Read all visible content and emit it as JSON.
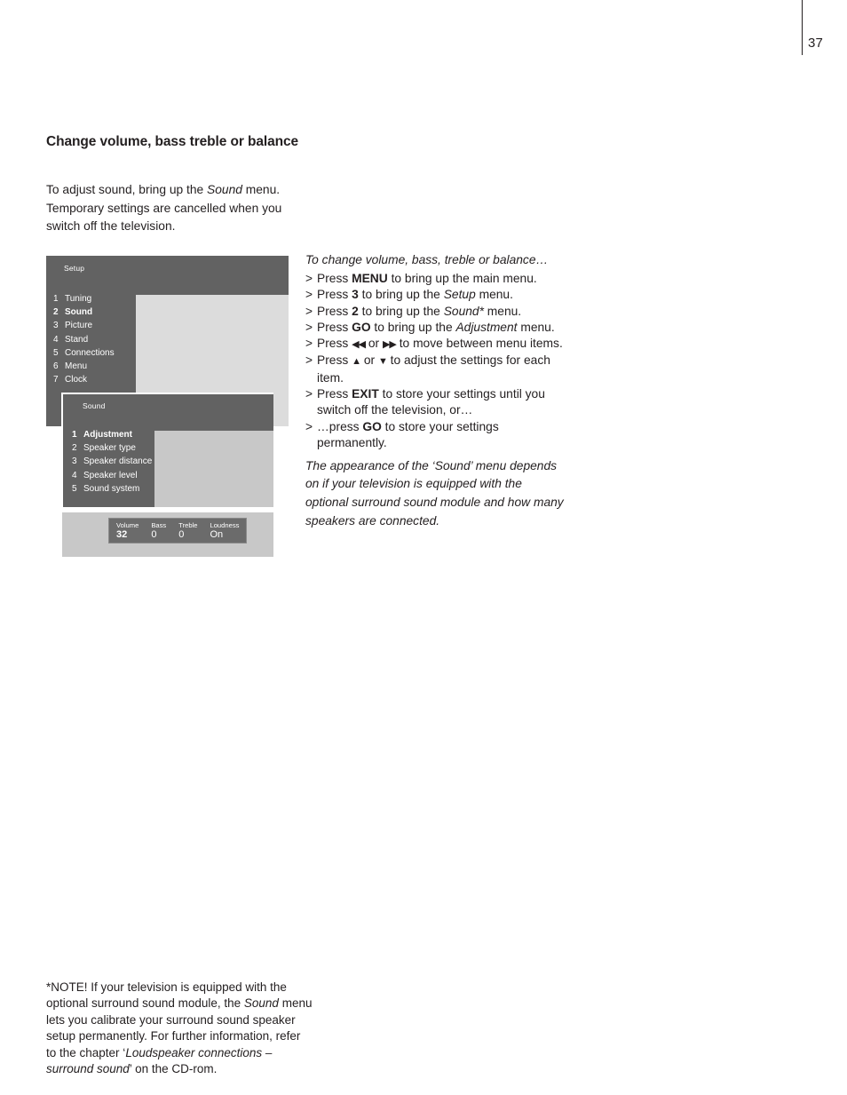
{
  "page": {
    "number": "37"
  },
  "headline": "Change volume, bass treble or balance",
  "intro": {
    "part1": "To adjust sound, bring up the ",
    "italic1": "Sound",
    "part2": " menu. Temporary settings are cancelled when you switch off the television."
  },
  "tv_graphic": {
    "setup_menu": {
      "title": "Setup",
      "items": [
        {
          "num": "1",
          "label": "Tuning",
          "selected": false
        },
        {
          "num": "2",
          "label": "Sound",
          "selected": true
        },
        {
          "num": "3",
          "label": "Picture",
          "selected": false
        },
        {
          "num": "4",
          "label": "Stand",
          "selected": false
        },
        {
          "num": "5",
          "label": "Connections",
          "selected": false
        },
        {
          "num": "6",
          "label": "Menu",
          "selected": false
        },
        {
          "num": "7",
          "label": "Clock",
          "selected": false
        }
      ]
    },
    "sound_menu": {
      "title": "Sound",
      "items": [
        {
          "num": "1",
          "label": "Adjustment",
          "selected": true
        },
        {
          "num": "2",
          "label": "Speaker type",
          "selected": false
        },
        {
          "num": "3",
          "label": "Speaker distance",
          "selected": false
        },
        {
          "num": "4",
          "label": "Speaker level",
          "selected": false
        },
        {
          "num": "5",
          "label": "Sound system",
          "selected": false
        }
      ]
    },
    "status_bar": [
      {
        "label": "Volume",
        "value": "32",
        "bold": true
      },
      {
        "label": "Bass",
        "value": "0",
        "bold": false
      },
      {
        "label": "Treble",
        "value": "0",
        "bold": false
      },
      {
        "label": "Loudness",
        "value": "On",
        "bold": false
      }
    ],
    "colors": {
      "menu_dark": "#626262",
      "menu_light": "#dcdcdc",
      "menu_light_alt": "#c8c8c8",
      "status_box": "#6b6b6b"
    }
  },
  "instructions": {
    "title": "To change volume, bass, treble or balance…",
    "marker": ">",
    "lines": [
      {
        "pre": "Press ",
        "key": "MENU",
        "post": " to bring up the main menu."
      },
      {
        "pre": "Press ",
        "key": "3",
        "post": " to bring up the ",
        "italic": "Setup",
        "tail": " menu."
      },
      {
        "pre": "Press ",
        "key": "2",
        "post": " to bring up the ",
        "italic": "Sound*",
        "tail": " menu."
      },
      {
        "pre": "Press ",
        "key": "GO",
        "post": " to bring up the ",
        "italic": "Adjustment",
        "tail": " menu."
      },
      {
        "pre": "Press ",
        "glyph_left": "◀◀",
        "mid": " or ",
        "glyph_right": "▶▶",
        "post": " to move between menu items."
      },
      {
        "pre": "Press ",
        "glyph_left": "▲",
        "mid": " or ",
        "glyph_right": "▼",
        "post": " to adjust the settings for each item."
      },
      {
        "pre": "Press ",
        "key": "EXIT",
        "post": " to store your settings until you switch off the television, or…"
      },
      {
        "pre": "…press ",
        "key": "GO",
        "post": " to store your settings permanently."
      }
    ]
  },
  "note_italic": "The appearance of the ‘Sound’ menu depends on if your television is equipped with the optional surround sound module and how many speakers are connected.",
  "footnote": {
    "seg1": "*NOTE! If your television is equipped with the optional surround sound module, the ",
    "italic1": "Sound",
    "seg2": " menu lets you calibrate your surround sound speaker setup permanently. For further information, refer to the chapter ‘",
    "italic2": "Loudspeaker connections – surround sound",
    "seg3": "’ on the CD-rom."
  }
}
